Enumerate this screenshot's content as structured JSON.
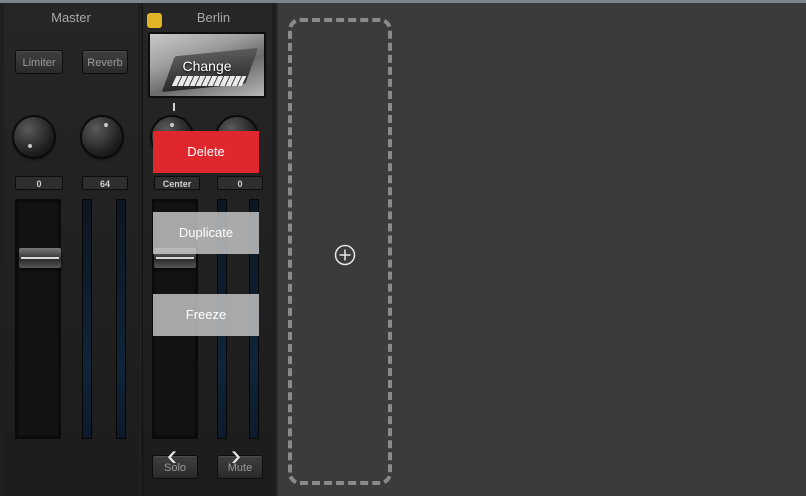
{
  "master": {
    "title": "Master",
    "limiter_label": "Limiter",
    "reverb_label": "Reverb",
    "knob_values": [
      "0",
      "64"
    ]
  },
  "track": {
    "title": "Berlin",
    "color": "#e0b427",
    "instrument_button_label": "Change",
    "knob_values": [
      "Center",
      "0"
    ],
    "solo_label": "Solo",
    "mute_label": "Mute"
  },
  "context_menu": {
    "items": [
      "Delete",
      "Duplicate",
      "Freeze"
    ],
    "delete_color": "#e0272e"
  },
  "nav": {
    "prev_glyph": "‹",
    "next_glyph": "›"
  },
  "workspace": {
    "add_icon": "plus-circle-icon"
  }
}
